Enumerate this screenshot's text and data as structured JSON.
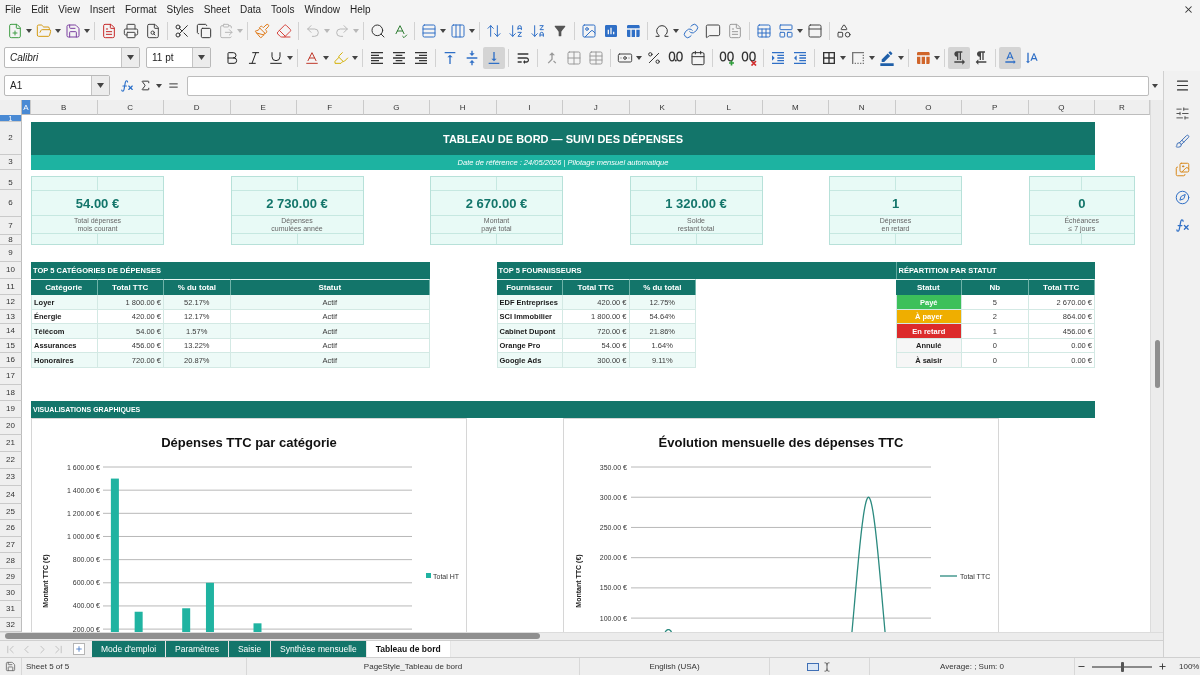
{
  "menu_bar": {
    "items": [
      "File",
      "Edit",
      "View",
      "Insert",
      "Format",
      "Styles",
      "Sheet",
      "Data",
      "Tools",
      "Window",
      "Help"
    ]
  },
  "standard_toolbar": {
    "clipboard": [
      {
        "disabled": false
      },
      {
        "disabled": false
      },
      {
        "disabled": true
      }
    ],
    "history": [
      {
        "disabled": true
      },
      {
        "disabled": true
      }
    ]
  },
  "formatting_toolbar": {
    "font_name": "Calibri",
    "font_size": "11 pt",
    "vertical_alignment": [
      {
        "selected": false
      },
      {
        "selected": false
      },
      {
        "selected": true
      }
    ],
    "paragraph_direction": [
      {
        "selected": true
      },
      {
        "selected": false
      }
    ],
    "text_flow": [
      {
        "selected": true
      },
      {
        "selected": false
      }
    ]
  },
  "formula_bar": {
    "cell_reference": "A1"
  },
  "sheet": {
    "columns": [
      {
        "label": "A",
        "selected": true
      },
      {
        "label": "B",
        "selected": false
      },
      {
        "label": "C",
        "selected": false
      },
      {
        "label": "D",
        "selected": false
      },
      {
        "label": "E",
        "selected": false
      },
      {
        "label": "F",
        "selected": false
      },
      {
        "label": "G",
        "selected": false
      },
      {
        "label": "H",
        "selected": false
      },
      {
        "label": "I",
        "selected": false
      },
      {
        "label": "J",
        "selected": false
      },
      {
        "label": "K",
        "selected": false
      },
      {
        "label": "L",
        "selected": false
      },
      {
        "label": "M",
        "selected": false
      },
      {
        "label": "N",
        "selected": false
      },
      {
        "label": "O",
        "selected": false
      },
      {
        "label": "P",
        "selected": false
      },
      {
        "label": "Q",
        "selected": false
      },
      {
        "label": "R",
        "selected": false
      }
    ],
    "rows": [
      {
        "label": "1",
        "selected": true
      },
      {
        "label": "2",
        "selected": false
      },
      {
        "label": "3",
        "selected": false
      },
      {
        "label": "5",
        "selected": false
      },
      {
        "label": "6",
        "selected": false
      },
      {
        "label": "7",
        "selected": false
      },
      {
        "label": "8",
        "selected": false
      },
      {
        "label": "9",
        "selected": false
      },
      {
        "label": "10",
        "selected": false
      },
      {
        "label": "11",
        "selected": false
      },
      {
        "label": "12",
        "selected": false
      },
      {
        "label": "13",
        "selected": false
      },
      {
        "label": "14",
        "selected": false
      },
      {
        "label": "15",
        "selected": false
      },
      {
        "label": "16",
        "selected": false
      },
      {
        "label": "17",
        "selected": false
      },
      {
        "label": "18",
        "selected": false
      },
      {
        "label": "19",
        "selected": false
      },
      {
        "label": "20",
        "selected": false
      },
      {
        "label": "21",
        "selected": false
      },
      {
        "label": "22",
        "selected": false
      },
      {
        "label": "23",
        "selected": false
      },
      {
        "label": "24",
        "selected": false
      },
      {
        "label": "25",
        "selected": false
      },
      {
        "label": "26",
        "selected": false
      },
      {
        "label": "27",
        "selected": false
      },
      {
        "label": "28",
        "selected": false
      },
      {
        "label": "29",
        "selected": false
      },
      {
        "label": "30",
        "selected": false
      },
      {
        "label": "31",
        "selected": false
      },
      {
        "label": "32",
        "selected": false
      }
    ],
    "banner": {
      "title": "TABLEAU DE BORD — SUIVI DES DÉPENSES",
      "subtitle": "Date de référence : 24/05/2026 | Pilotage mensuel automatique"
    },
    "kpi_cards": [
      {
        "value": "54.00 €",
        "label": "Total dépenses\nmois courant"
      },
      {
        "value": "2 730.00 €",
        "label": "Dépenses\ncumulées année"
      },
      {
        "value": "2 670.00 €",
        "label": "Montant\npayé total"
      },
      {
        "value": "1 320.00 €",
        "label": "Solde\nrestant total"
      },
      {
        "value": "1",
        "label": "Dépenses\nen retard"
      },
      {
        "value": "0",
        "label": "Échéances\n≤ 7 jours"
      }
    ],
    "top_categories": {
      "title": "TOP 5 CATÉGORIES DE DÉPENSES",
      "columns": [
        "Catégorie",
        "Total TTC",
        "% du total",
        "Statut"
      ],
      "rows": [
        [
          "Loyer",
          "1 800.00 €",
          "52.17%",
          "Actif"
        ],
        [
          "Énergie",
          "420.00 €",
          "12.17%",
          "Actif"
        ],
        [
          "Télécom",
          "54.00 €",
          "1.57%",
          "Actif"
        ],
        [
          "Assurances",
          "456.00 €",
          "13.22%",
          "Actif"
        ],
        [
          "Honoraires",
          "720.00 €",
          "20.87%",
          "Actif"
        ]
      ]
    },
    "top_suppliers": {
      "title": "TOP 5 FOURNISSEURS",
      "columns": [
        "Fournisseur",
        "Total TTC",
        "% du total"
      ],
      "rows": [
        [
          "EDF Entreprises",
          "420.00 €",
          "12.75%"
        ],
        [
          "SCI Immobilier",
          "1 800.00 €",
          "54.64%"
        ],
        [
          "Cabinet Dupont",
          "720.00 €",
          "21.86%"
        ],
        [
          "Orange Pro",
          "54.00 €",
          "1.64%"
        ],
        [
          "Google Ads",
          "300.00 €",
          "9.11%"
        ]
      ]
    },
    "status_breakdown": {
      "title": "RÉPARTITION PAR STATUT",
      "columns": [
        "Statut",
        "Nb",
        "Total TTC"
      ],
      "rows": [
        {
          "status": "Payé",
          "color": "#3cc05a",
          "count": "5",
          "total": "2 670.00 €"
        },
        {
          "status": "À payer",
          "color": "#efae00",
          "count": "2",
          "total": "864.00 €"
        },
        {
          "status": "En retard",
          "color": "#dc2b2b",
          "count": "1",
          "total": "456.00 €"
        },
        {
          "status": "Annulé",
          "count": "0",
          "total": "0.00 €"
        },
        {
          "status": "À saisir",
          "count": "0",
          "total": "0.00 €"
        }
      ]
    },
    "charts_section": {
      "title": "VISUALISATIONS GRAPHIQUES",
      "charts": [
        {
          "chart_data": {
            "type": "bar",
            "title": "Dépenses TTC par catégorie",
            "ylabel": "Montant TTC (€)",
            "categories": [
              null,
              null,
              null,
              null,
              null,
              null,
              null,
              null,
              null,
              null,
              null,
              null,
              null
            ],
            "series": [
              {
                "name": "Total HT",
                "color": "#20b3a1",
                "values": [
                  1500,
                  350,
                  null,
                  380,
                  600,
                  null,
                  250,
                  null,
                  null,
                  null,
                  null,
                  null,
                  null
                ]
              }
            ],
            "ylim": [
              175,
              1600
            ],
            "grid": true,
            "yticks": [
              {
                "value": 200,
                "label": "200.00 €"
              },
              {
                "value": 400,
                "label": "400.00 €"
              },
              {
                "value": 600,
                "label": "600.00 €"
              },
              {
                "value": 800,
                "label": "800.00 €"
              },
              {
                "value": 1000,
                "label": "1 000.00 €"
              },
              {
                "value": 1200,
                "label": "1 200.00 €"
              },
              {
                "value": 1400,
                "label": "1 400.00 €"
              },
              {
                "value": 1600,
                "label": "1 600.00 €"
              }
            ]
          }
        },
        {
          "chart_data": {
            "type": "line",
            "title": "Évolution mensuelle des dépenses TTC",
            "ylabel": "Montant TTC (€)",
            "categories": [
              null,
              null,
              null,
              null,
              null,
              null,
              null,
              null,
              null,
              null,
              null,
              null
            ],
            "series": [
              {
                "name": "Total TTC",
                "color": "#2b8a7f",
                "values": [
                  null,
                  81,
                  null,
                  null,
                  null,
                  null,
                  null,
                  null,
                  null,
                  300,
                  null,
                  null
                ]
              }
            ],
            "ylim": [
              77,
              350
            ],
            "grid": true,
            "yticks": [
              {
                "value": 100,
                "label": "100.00 €"
              },
              {
                "value": 150,
                "label": "150.00 €"
              },
              {
                "value": 200,
                "label": "200.00 €"
              },
              {
                "value": 250,
                "label": "250.00 €"
              },
              {
                "value": 300,
                "label": "300.00 €"
              },
              {
                "value": 350,
                "label": "350.00 €"
              }
            ]
          }
        }
      ]
    }
  },
  "sheet_tabs": {
    "navigation": [
      {
        "disabled": true
      },
      {
        "disabled": true
      },
      {
        "disabled": true
      },
      {
        "disabled": true
      }
    ],
    "tabs": [
      {
        "label": "Mode d'emploi",
        "selected": false
      },
      {
        "label": "Paramètres",
        "selected": false
      },
      {
        "label": "Saisie",
        "selected": false
      },
      {
        "label": "Synthèse mensuelle",
        "selected": false
      },
      {
        "label": "Tableau de bord",
        "selected": true
      }
    ]
  },
  "status_bar": {
    "sheet_position": "Sheet 5 of 5",
    "page_style": "PageStyle_Tableau de bord",
    "language": "English (USA)",
    "summary": "Average: ; Sum: 0",
    "zoom": {
      "level": 0.5,
      "reading": "100%"
    }
  }
}
